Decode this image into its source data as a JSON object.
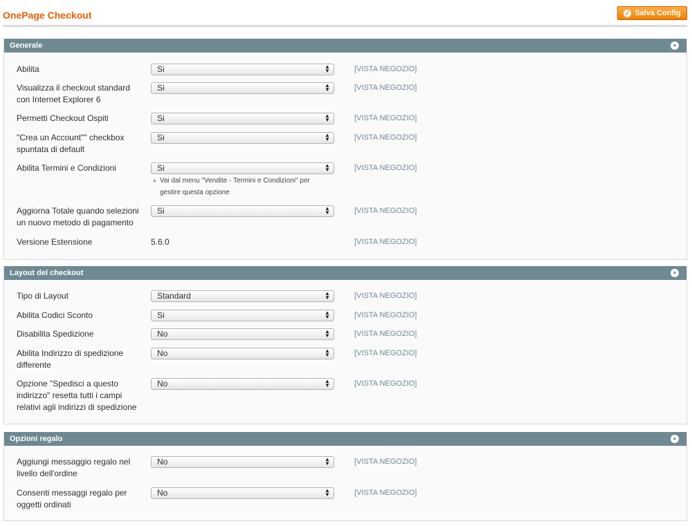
{
  "page": {
    "title": "OnePage Checkout",
    "save_label": "Salva Config"
  },
  "sections": [
    {
      "title": "Generale",
      "rows": [
        {
          "label": "Abilita",
          "value": "Si",
          "scope": "[VISTA NEGOZIO]"
        },
        {
          "label": "Visualizza il checkout standard con Internet Explorer 6",
          "value": "Si",
          "scope": "[VISTA NEGOZIO]"
        },
        {
          "label": "Permetti Checkout Ospiti",
          "value": "Si",
          "scope": "[VISTA NEGOZIO]"
        },
        {
          "label": "\"Crea un Account\"\" checkbox spuntata di default",
          "value": "Si",
          "scope": "[VISTA NEGOZIO]"
        },
        {
          "label": "Abilita Termini e Condizioni",
          "value": "Si",
          "scope": "[VISTA NEGOZIO]",
          "hint": "Vai dal menu \"Vendite - Termini e Condizioni\" per gestire questa opzione"
        },
        {
          "label": "Aggiorna Totale quando selezioni un nuovo metodo di pagamento",
          "value": "Si",
          "scope": "[VISTA NEGOZIO]"
        },
        {
          "label": "Versione Estensione",
          "static": "5.6.0",
          "scope": "[VISTA NEGOZIO]"
        }
      ]
    },
    {
      "title": "Layout del checkout",
      "rows": [
        {
          "label": "Tipo di Layout",
          "value": "Standard",
          "scope": "[VISTA NEGOZIO]"
        },
        {
          "label": "Abilita Codici Sconto",
          "value": "Si",
          "scope": "[VISTA NEGOZIO]"
        },
        {
          "label": "Disabilita Spedizione",
          "value": "No",
          "scope": "[VISTA NEGOZIO]"
        },
        {
          "label": "Abilita Indirizzo di spedizione differente",
          "value": "No",
          "scope": "[VISTA NEGOZIO]"
        },
        {
          "label": "Opzione \"Spedisci a questo indirizzo\" resetta tutti i campi relativi agli indirizzi di spedizione",
          "value": "No",
          "scope": "[VISTA NEGOZIO]"
        }
      ]
    },
    {
      "title": "Opzioni regalo",
      "rows": [
        {
          "label": "Aggiungi messaggio regalo nel livello dell'ordine",
          "value": "No",
          "scope": "[VISTA NEGOZIO]"
        },
        {
          "label": "Consenti messaggi regalo per oggetti ordinati",
          "value": "No",
          "scope": "[VISTA NEGOZIO]"
        }
      ]
    }
  ],
  "colors": {
    "accent": "#eb5e00",
    "header": "#6f8992",
    "button": "#f18200"
  },
  "icons": {
    "save": "check-circle-icon",
    "collapse": "collapse-up-icon",
    "select": "select-arrows-icon"
  }
}
